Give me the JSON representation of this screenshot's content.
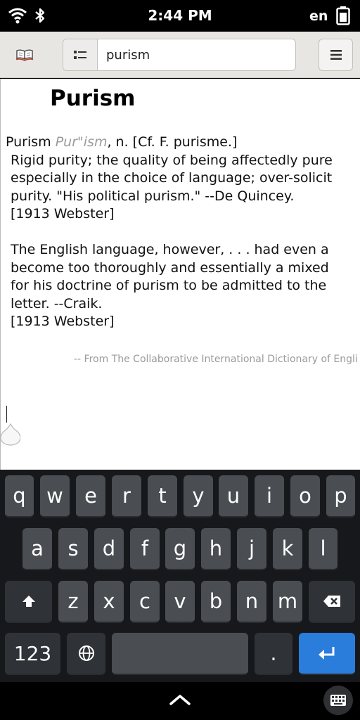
{
  "status_bar": {
    "time": "2:44 PM",
    "language": "en",
    "icons": [
      "wifi-icon",
      "bluetooth-icon",
      "battery-icon"
    ]
  },
  "header": {
    "search_value": "purism",
    "icons": [
      "book-icon",
      "list-mode-icon",
      "hamburger-menu-icon"
    ]
  },
  "entry": {
    "title": "Purism",
    "headword": "Purism",
    "pronunciation": "Pur\"ism",
    "grammar": ", n. [Cf. F. purisme.]",
    "lines": [
      "Rigid purity; the quality of being affectedly pure",
      "especially in the choice of language; over-solicit",
      "purity. \"His political purism.\" --De Quincey.",
      "[1913 Webster]"
    ],
    "lines2": [
      "The English language, however, . . . had even a",
      "become too thoroughly and essentially a mixed",
      "for his doctrine of purism to be admitted to the",
      "letter. --Craik.",
      "[1913 Webster]"
    ],
    "source": "-- From The Collaborative International Dictionary of Engli"
  },
  "keyboard": {
    "row1": [
      "q",
      "w",
      "e",
      "r",
      "t",
      "y",
      "u",
      "i",
      "o",
      "p"
    ],
    "row2": [
      "a",
      "s",
      "d",
      "f",
      "g",
      "h",
      "j",
      "k",
      "l"
    ],
    "row3": [
      "z",
      "x",
      "c",
      "v",
      "b",
      "n",
      "m"
    ],
    "numbers_label": "123",
    "period_label": ".",
    "colors": {
      "key": "#4a4d52",
      "special_key": "#2f3236",
      "enter_key": "#2a7ddb",
      "background": "#16181b"
    }
  },
  "nav_bar": {
    "icons": [
      "chevron-up-icon",
      "keyboard-icon"
    ]
  }
}
